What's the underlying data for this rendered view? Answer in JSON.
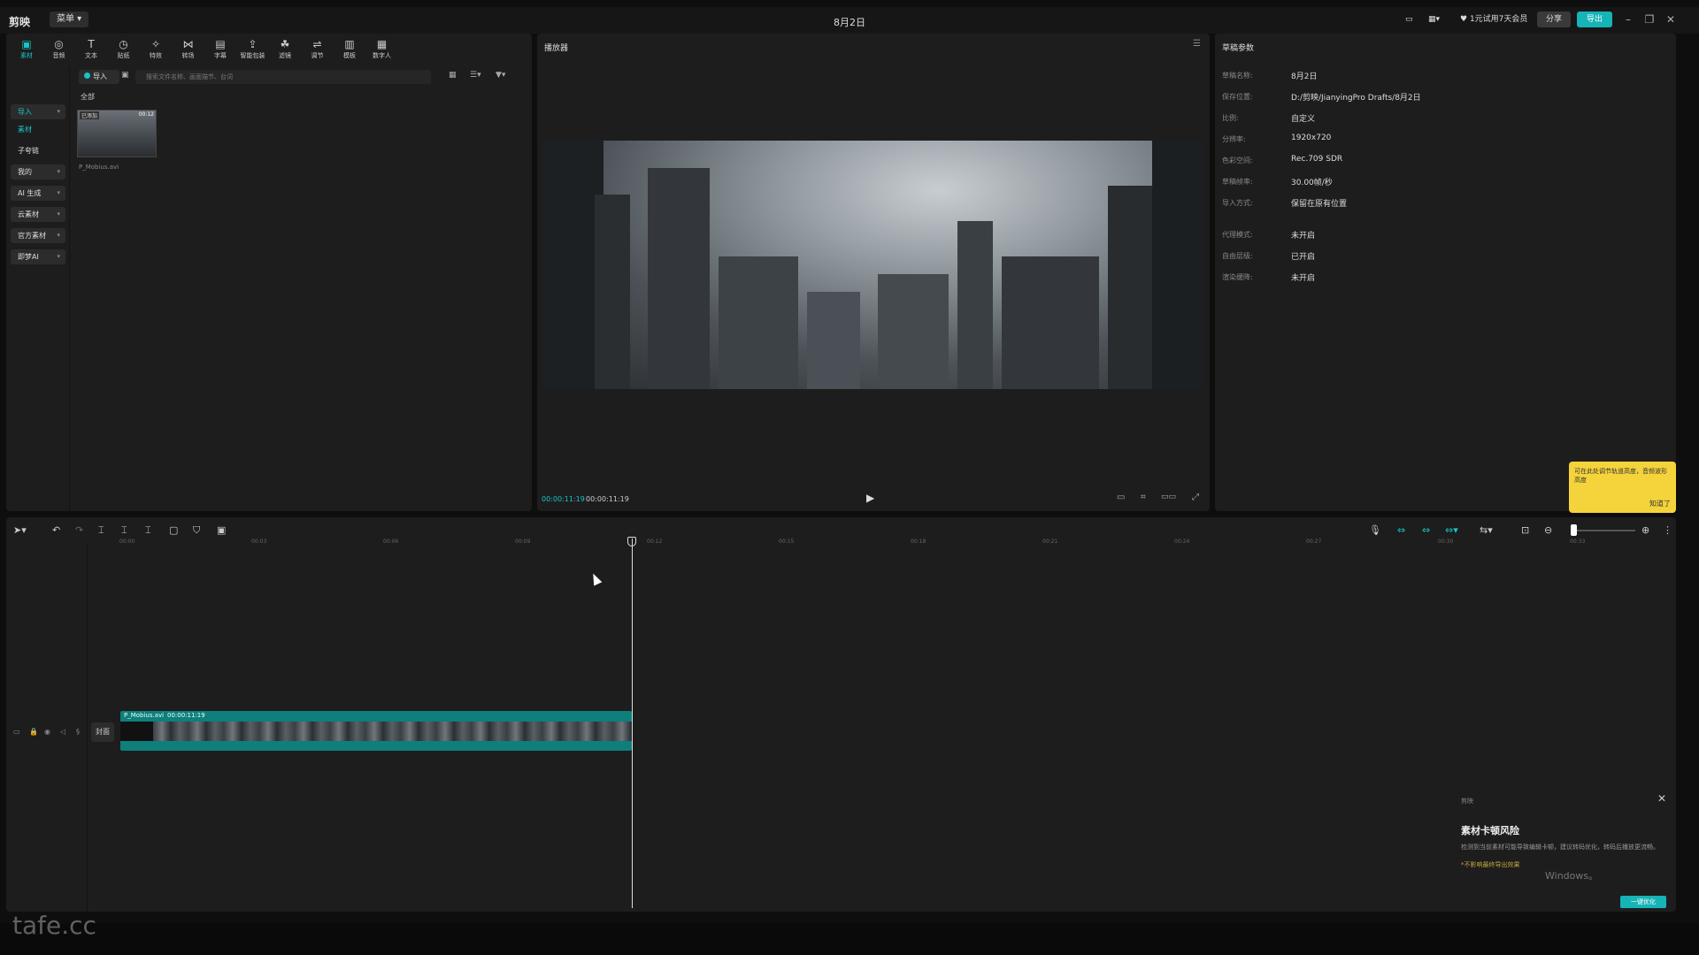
{
  "titlebar": {
    "app_name": "剪映",
    "menu": "菜单",
    "project_title": "8月2日",
    "vip": "1元试用7天会员",
    "share": "分享",
    "export": "导出"
  },
  "media_tools": [
    {
      "icon": "media-icon",
      "label": "素材",
      "active": true
    },
    {
      "icon": "audio-icon",
      "label": "音频"
    },
    {
      "icon": "text-icon",
      "label": "文本"
    },
    {
      "icon": "sticker-icon",
      "label": "贴纸"
    },
    {
      "icon": "effects-icon",
      "label": "特效"
    },
    {
      "icon": "transition-icon",
      "label": "转场"
    },
    {
      "icon": "caption-icon",
      "label": "字幕"
    },
    {
      "icon": "smart-pack-icon",
      "label": "智能包装"
    },
    {
      "icon": "filter-icon",
      "label": "滤镜"
    },
    {
      "icon": "adjust-icon",
      "label": "调节"
    },
    {
      "icon": "template-icon",
      "label": "模板"
    },
    {
      "icon": "digital-human-icon",
      "label": "数字人"
    }
  ],
  "left_sidebar": {
    "import": "导入",
    "items": [
      {
        "label": "素材",
        "active": true
      },
      {
        "label": "子夸链"
      },
      {
        "label": "我的",
        "box": true
      },
      {
        "label": "AI 生成",
        "box": true
      },
      {
        "label": "云素材",
        "box": true
      },
      {
        "label": "官方素材",
        "box": true
      },
      {
        "label": "即梦AI",
        "box": true
      }
    ]
  },
  "media_panel": {
    "import_label": "导入",
    "search_placeholder": "搜索文件名称、画面描节、台词",
    "filter_all": "全部",
    "items": [
      {
        "name": "P_Mobius.avi",
        "badge": "已添加",
        "duration": "00:12"
      }
    ]
  },
  "player": {
    "title": "播放器",
    "current_time": "00:00:11:19",
    "total_time": "00:00:11:19"
  },
  "properties": {
    "title": "草稿参数",
    "rows": [
      {
        "label": "草稿名称:",
        "value": "8月2日"
      },
      {
        "label": "保存位置:",
        "value": "D:/剪映/JianyingPro Drafts/8月2日"
      },
      {
        "label": "比例:",
        "value": "自定义"
      },
      {
        "label": "分辨率:",
        "value": "1920x720"
      },
      {
        "label": "色彩空间:",
        "value": "Rec.709 SDR"
      },
      {
        "label": "草稿帧率:",
        "value": "30.00帧/秒"
      },
      {
        "label": "导入方式:",
        "value": "保留在原有位置"
      },
      {
        "label": "代理模式:",
        "value": "未开启"
      },
      {
        "label": "自由层级:",
        "value": "已开启"
      },
      {
        "label": "渲染缓降:",
        "value": "未开启"
      }
    ]
  },
  "tooltip": {
    "text": "可在此处调节轨道高度，音频波形高度",
    "ok": "知道了"
  },
  "timeline": {
    "ticks": [
      "00:00",
      "00:03",
      "00:06",
      "00:09",
      "00:12",
      "00:15",
      "00:18",
      "00:21",
      "00:24",
      "00:27",
      "00:30",
      "00:33"
    ],
    "cover_label": "封面",
    "clip": {
      "name": "P_Mobius.avi",
      "duration": "00:00:11:19"
    }
  },
  "notification": {
    "app": "剪映",
    "title": "素材卡顿风险",
    "body": "检测到当前素材可能导致编辑卡顿，建议转码优化，转码后播放更流畅。",
    "warn": "*不影响最终导出效果",
    "action": "一键优化",
    "windows_watermark": "Windows。"
  },
  "watermark": "tafe.cc"
}
